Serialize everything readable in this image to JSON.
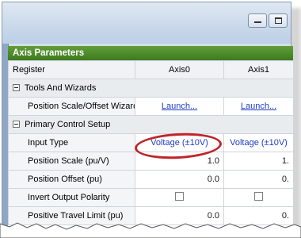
{
  "panel": {
    "title": "Axis Parameters"
  },
  "table": {
    "headers": [
      "Register",
      "Axis0",
      "Axis1"
    ],
    "rows": [
      {
        "kind": "category",
        "label": "Tools And Wizards"
      },
      {
        "kind": "item",
        "label": "Position Scale/Offset Wizard",
        "axis0": "Launch...",
        "axis1": "Launch...",
        "type": "link"
      },
      {
        "kind": "category",
        "label": "Primary Control Setup"
      },
      {
        "kind": "item",
        "label": "Input Type",
        "axis0": "Voltage (±10V)",
        "axis1": "Voltage (±10V)",
        "type": "select"
      },
      {
        "kind": "item",
        "label": "Position Scale (pu/V)",
        "axis0": "1.0",
        "axis1": "1.",
        "type": "value"
      },
      {
        "kind": "item",
        "label": "Position Offset (pu)",
        "axis0": "0.0",
        "axis1": "0.",
        "type": "value"
      },
      {
        "kind": "item",
        "label": "Invert Output Polarity",
        "axis0": "",
        "axis1": "",
        "type": "checkbox"
      },
      {
        "kind": "item",
        "label": "Positive Travel Limit (pu)",
        "axis0": "0.0",
        "axis1": "0.",
        "type": "value"
      }
    ]
  },
  "colors": {
    "panel_header": "#4a8a2a",
    "link": "#1f3cc4",
    "highlight_oval": "#c0252a"
  }
}
